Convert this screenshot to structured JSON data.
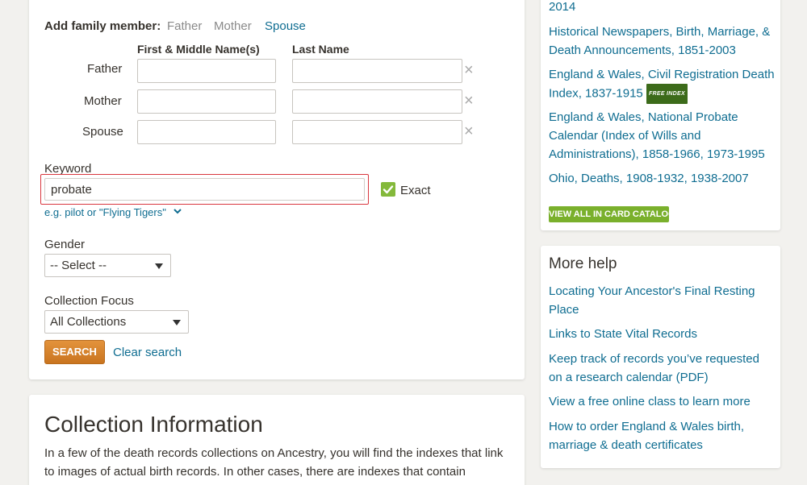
{
  "search_form": {
    "add_family_label": "Add family member:",
    "add_family_options": [
      "Father",
      "Mother",
      "Spouse"
    ],
    "first_name_header": "First & Middle Name(s)",
    "last_name_header": "Last Name",
    "rows": [
      {
        "label": "Father",
        "first": "",
        "last": ""
      },
      {
        "label": "Mother",
        "first": "",
        "last": ""
      },
      {
        "label": "Spouse",
        "first": "",
        "last": ""
      }
    ],
    "keyword_label": "Keyword",
    "keyword_value": "probate",
    "exact_label": "Exact",
    "keyword_hint": "e.g. pilot or \"Flying Tigers\"",
    "gender_label": "Gender",
    "gender_value": "-- Select --",
    "collection_focus_label": "Collection Focus",
    "collection_focus_value": "All Collections",
    "search_button": "SEARCH",
    "clear_search": "Clear search",
    "remove_icon": "×"
  },
  "collection_info": {
    "title": "Collection Information",
    "body_line1": "In a few of the death records collections on Ancestry, you will find the indexes that link",
    "body_line2": "to images of actual birth records. In other cases, there are indexes that contain"
  },
  "records_panel": {
    "links": [
      {
        "text": "2014"
      },
      {
        "text": "Historical Newspapers, Birth, Marriage, & Death Announcements, 1851-2003"
      },
      {
        "text": "England & Wales, Civil Registration Death Index, 1837-1915",
        "badge": "FREE INDEX"
      },
      {
        "text": "England & Wales, National Probate Calendar (Index of Wills and Administrations), 1858-1966, 1973-1995"
      },
      {
        "text": "Ohio, Deaths, 1908-1932, 1938-2007"
      }
    ],
    "view_all_button": "VIEW ALL IN CARD CATALOG"
  },
  "more_help": {
    "title": "More help",
    "links": [
      "Locating Your Ancestor's Final Resting Place",
      "Links to State Vital Records",
      "Keep track of records you’ve requested on a research calendar (PDF)",
      "View a free online class to learn more",
      "How to order England & Wales birth, marriage & death certificates"
    ]
  },
  "colors": {
    "link": "#0f6d91",
    "search_button": "#d9832a",
    "view_all_button": "#7ab02c",
    "highlight_border": "#d9363e",
    "checkbox": "#84b93b"
  }
}
